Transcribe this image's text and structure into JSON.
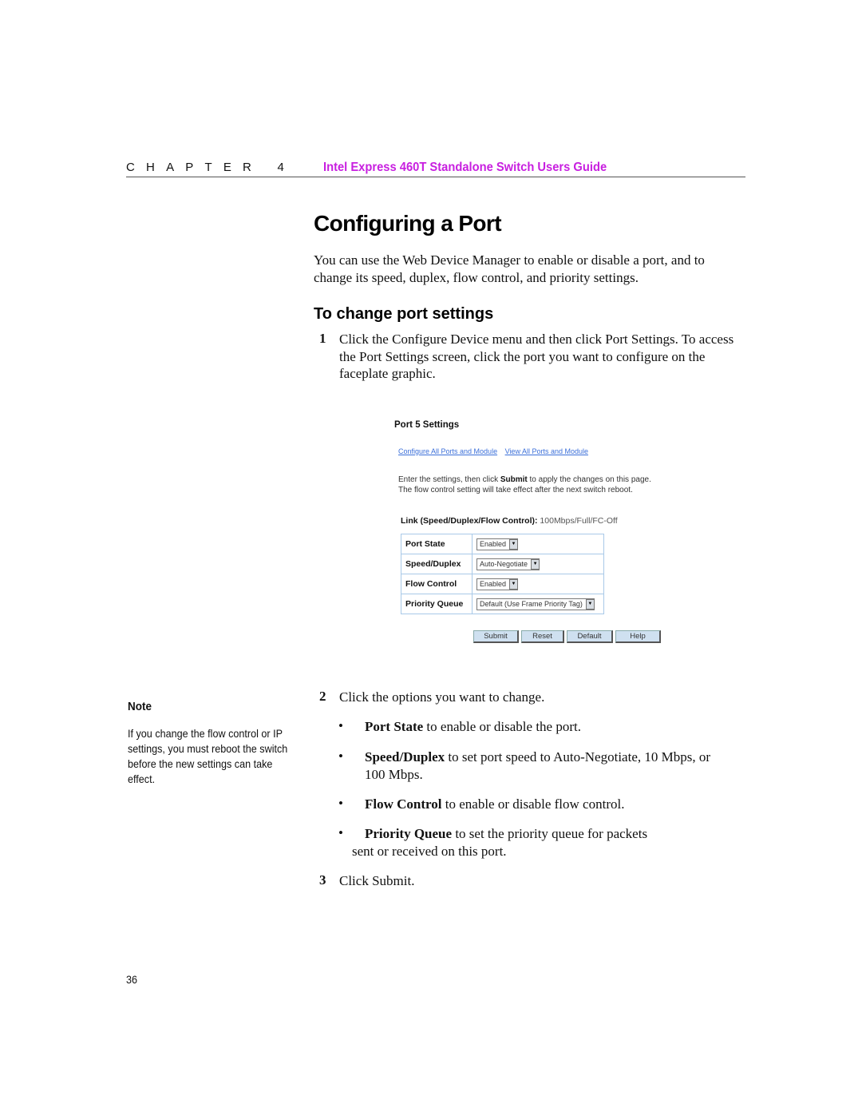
{
  "header": {
    "chapter_label": "CHAPTER 4",
    "chapter_title": "Intel Express 460T Standalone Switch Users Guide",
    "title_color": "#c81fe0"
  },
  "page_title": "Configuring a Port",
  "intro": "You can use the Web Device Manager to enable or disable a port, and to change its speed, duplex, flow control, and priority settings.",
  "section_heading": "To change port settings",
  "steps": [
    {
      "num": "1",
      "text": "Click the Configure Device menu and then click Port Settings. To access the Port Settings screen, click the port you want to configure on the faceplate graphic."
    },
    {
      "num": "2",
      "text": "Click the options you want to change."
    },
    {
      "num": "3",
      "text": "Click Submit."
    }
  ],
  "bullets": [
    {
      "bold": "Port State",
      "text": " to enable or disable the port."
    },
    {
      "bold": "Speed/Duplex",
      "text": " to set port speed to Auto-Negotiate, 10 Mbps, or 100 Mbps."
    },
    {
      "bold": "Flow Control",
      "text": " to enable or disable flow control."
    },
    {
      "bold": "Priority Queue",
      "text": " to set the priority queue for packets sent or received on this port."
    }
  ],
  "screenshot": {
    "title": "Port 5 Settings",
    "links": [
      "Configure All Ports and Module",
      "View All Ports and Module"
    ],
    "desc_pre": "Enter the settings, then click ",
    "desc_bold": "Submit",
    "desc_post": " to apply the changes on this page. The flow control setting will take effect after the next switch reboot.",
    "link_status_label": "Link (Speed/Duplex/Flow Control):",
    "link_status_value": "100Mbps/Full/FC-Off",
    "rows": [
      {
        "label": "Port State",
        "value": "Enabled"
      },
      {
        "label": "Speed/Duplex",
        "value": "Auto-Negotiate"
      },
      {
        "label": "Flow Control",
        "value": "Enabled"
      },
      {
        "label": "Priority Queue",
        "value": "Default (Use Frame Priority Tag)"
      }
    ],
    "buttons": [
      "Submit",
      "Reset",
      "Default",
      "Help"
    ]
  },
  "note": {
    "title": "Note",
    "body": "If you change the flow control or IP settings, you must reboot the switch before the new settings can take effect."
  },
  "page_number": "36"
}
